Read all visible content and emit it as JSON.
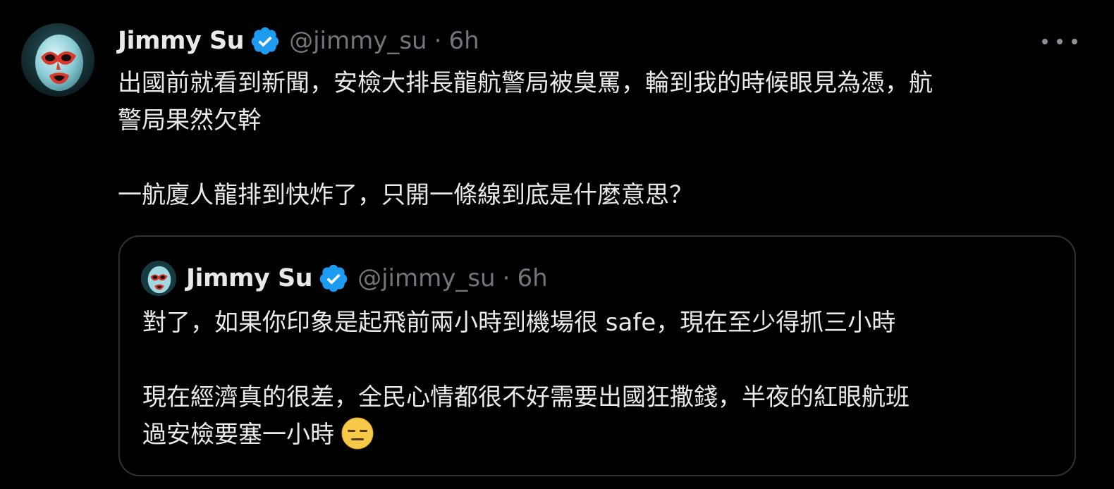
{
  "tweet": {
    "author": {
      "display_name": "Jimmy Su",
      "handle": "@jimmy_su",
      "verified": true,
      "avatar_icon": "wrestler-mask-avatar"
    },
    "separator": "·",
    "time": "6h",
    "more_icon": "more-horizontal-icon",
    "text_lines": [
      "出國前就看到新聞，安檢大排長龍航警局被臭罵，輪到我的時候眼見為憑，航",
      "警局果然欠幹",
      "一航廈人龍排到快炸了，只開一條線到底是什麼意思？"
    ]
  },
  "quoted_tweet": {
    "author": {
      "display_name": "Jimmy Su",
      "handle": "@jimmy_su",
      "verified": true,
      "avatar_icon": "wrestler-mask-avatar"
    },
    "separator": "·",
    "time": "6h",
    "text_lines": [
      "對了，如果你印象是起飛前兩小時到機場很 safe，現在至少得抓三小時",
      "現在經濟真的很差，全民心情都很不好需要出國狂撒錢，半夜的紅眼航班",
      "過安檢要塞一小時"
    ],
    "emoji": "expressionless-face-emoji"
  },
  "colors": {
    "background": "#000000",
    "text_primary": "#e7e9ea",
    "text_secondary": "#71767b",
    "verified_blue": "#1d9bf0",
    "border": "#2f3336"
  }
}
